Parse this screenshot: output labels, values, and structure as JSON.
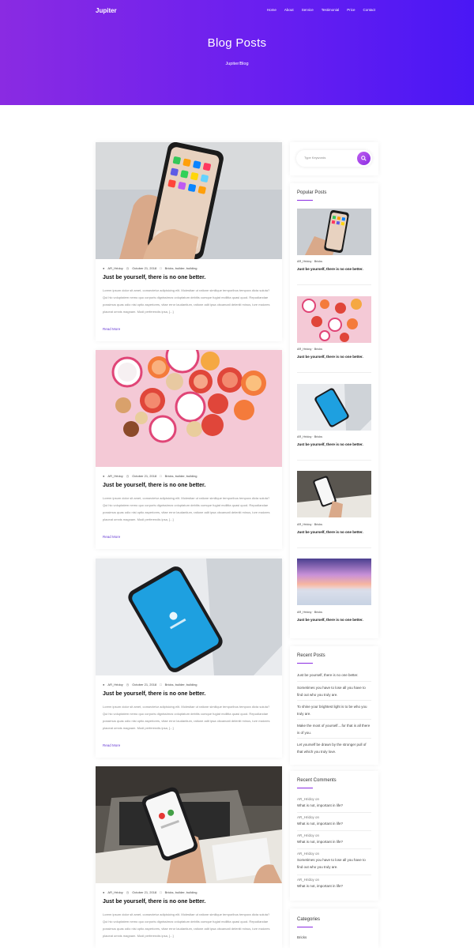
{
  "header": {
    "logo": "Jupiter",
    "nav": [
      "Home",
      "About",
      "Service",
      "Testimonial",
      "Price",
      "Contact"
    ],
    "title": "Blog Posts",
    "breadcrumb": "Jupiter/Blog"
  },
  "posts": [
    {
      "author": "AR_Hridoy",
      "date": "October 21, 2018",
      "tags": "Bricks, builder, building",
      "title": "Just be yourself, there is no one better.",
      "excerpt": "Lorem ipsum dolor sit amet, consectetur adipisicing elit. Molestiae ut ratione similique temporibus tempora dicta soluta? Qui hic voluptatem nemo quo corporis dignissimos voluptatum debitis cumque fugiat mollitia quasi quod. Repudiandae possimus quas odio nisi optio asperiores, vitae error laudantium, ratione adit ipsa obcaecati deleniti minus, iure maiores placeat omnis magnam. Modi perferendis ipsa, [...]",
      "more": "Read More",
      "image": "phone-home-screen"
    },
    {
      "author": "AR_Hridoy",
      "date": "October 21, 2018",
      "tags": "Bricks, builder, building",
      "title": "Just be yourself, there is no one better.",
      "excerpt": "Lorem ipsum dolor sit amet, consectetur adipisicing elit. Molestiae ut ratione similique temporibus tempora dicta soluta? Qui hic voluptatem nemo quo corporis dignissimos voluptatum debitis cumque fugiat mollitia quasi quod. Repudiandae possimus quas odio nisi optio asperiores, vitae error laudantium, ratione adit ipsa obcaecati deleniti minus, iure maiores placeat omnis magnam. Modi perferendis ipsa, [...]",
      "more": "Read More",
      "image": "fruit-slices"
    },
    {
      "author": "AR_Hridoy",
      "date": "October 21, 2018",
      "tags": "Bricks, builder, building",
      "title": "Just be yourself, there is no one better.",
      "excerpt": "Lorem ipsum dolor sit amet, consectetur adipisicing elit. Molestiae ut ratione similique temporibus tempora dicta soluta? Qui hic voluptatem nemo quo corporis dignissimos voluptatum debitis cumque fugiat mollitia quasi quod. Repudiandae possimus quas odio nisi optio asperiores, vitae error laudantium, ratione adit ipsa obcaecati deleniti minus, iure maiores placeat omnis magnam. Modi perferendis ipsa, [...]",
      "more": "Read More",
      "image": "phone-blue-screen"
    },
    {
      "author": "AR_Hridoy",
      "date": "October 21, 2018",
      "tags": "Bricks, builder, building",
      "title": "Just be yourself, there is no one better.",
      "excerpt": "Lorem ipsum dolor sit amet, consectetur adipisicing elit. Molestiae ut ratione similique temporibus tempora dicta soluta? Qui hic voluptatem nemo quo corporis dignissimos voluptatum debitis cumque fugiat mollitia quasi quod. Repudiandae possimus quas odio nisi optio asperiores, vitae error laudantium, ratione adit ipsa obcaecati deleniti minus, iure maiores placeat omnis magnam. Modi perferendis ipsa, [...]",
      "more": "Read More",
      "image": "phone-laptop-desk"
    }
  ],
  "sidebar": {
    "search_placeholder": "Type Keywords",
    "popular_title": "Popular Posts",
    "popular": [
      {
        "author": "AR_Hridoy",
        "tags": "Bricks",
        "title": "Just be yourself, there is no one better."
      },
      {
        "author": "AR_Hridoy",
        "tags": "Bricks",
        "title": "Just be yourself, there is no one better."
      },
      {
        "author": "AR_Hridoy",
        "tags": "Bricks",
        "title": "Just be yourself, there is no one better."
      },
      {
        "author": "AR_Hridoy",
        "tags": "Bricks",
        "title": "Just be yourself, there is no one better."
      },
      {
        "author": "AR_Hridoy",
        "tags": "Bricks",
        "title": "Just be yourself, there is no one better."
      }
    ],
    "recent_title": "Recent Posts",
    "recent": [
      "Just be yourself, there is no one better.",
      "Sometimes you have to lose all you have to find out who you truly are.",
      "To shine your brightest light is to be who you truly are.",
      "Make the most of yourself....for that is all there is of you.",
      "Let yourself be drawn by the stronger pull of that which you truly love."
    ],
    "comments_title": "Recent Comments",
    "comments": [
      {
        "author": "AR_Hridoy on",
        "text": "What is not, important in life?"
      },
      {
        "author": "AR_Hridoy on",
        "text": "What is not, important in life?"
      },
      {
        "author": "AR_Hridoy on",
        "text": "What is not, important in life?"
      },
      {
        "author": "AR_Hridoy on",
        "text": "Sometimes you have to lose all you have to find out who you truly are."
      },
      {
        "author": "AR_Hridoy on",
        "text": "What is not, important in life?"
      }
    ],
    "categories_title": "Categories",
    "categories": [
      "Bricks"
    ]
  }
}
